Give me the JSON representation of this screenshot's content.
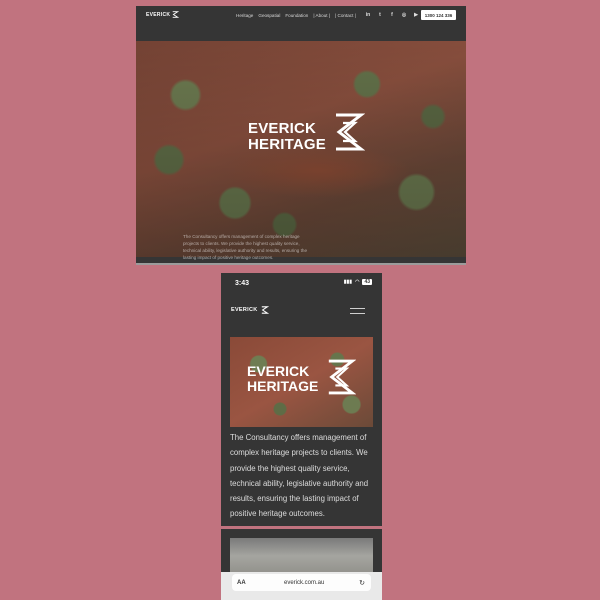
{
  "desktop": {
    "logo_text": "EVERICK",
    "nav": [
      "Heritage",
      "Geospatial",
      "Foundation",
      "| About |",
      "| Contact |"
    ],
    "social": [
      "in",
      "t",
      "f",
      "◎",
      "▶"
    ],
    "phone": "1300 124 336",
    "hero_title_line1": "EVERICK",
    "hero_title_line2": "HERITAGE",
    "hero_text": "The Consultancy offers management of complex heritage projects to clients. We provide the highest quality service, technical ability, legislative authority and results, ensuring the lasting impact of positive heritage outcomes."
  },
  "mobile": {
    "time": "3:43",
    "signal": "▮▮▮",
    "wifi": "◠",
    "battery": "43",
    "logo_text": "EVERICK",
    "card_title_line1": "EVERICK",
    "card_title_line2": "HERITAGE",
    "body_text": "The Consultancy offers management of complex heritage projects to clients. We provide the highest quality service, technical ability, legislative authority and results, ensuring the lasting impact of positive heritage outcomes.",
    "address_bar": {
      "aa_label": "AA",
      "url": "everick.com.au",
      "reload_icon": "↻"
    }
  },
  "colors": {
    "background": "#c1737f",
    "panel": "#353535",
    "text_light": "#ffffff"
  }
}
